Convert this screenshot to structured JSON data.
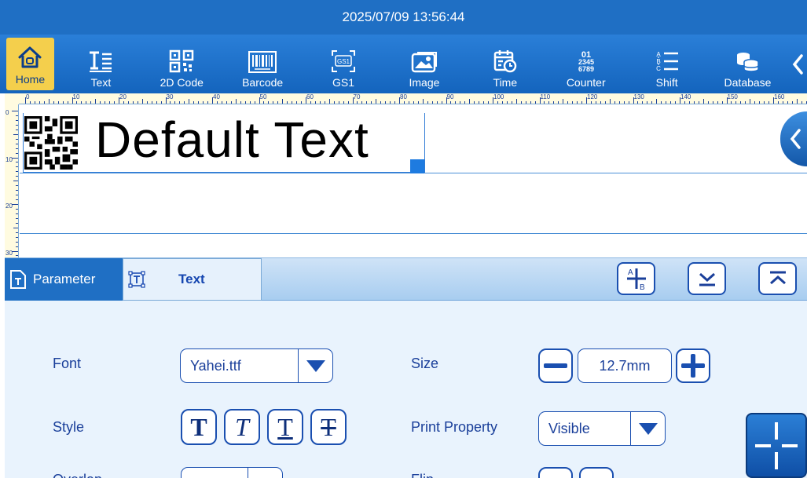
{
  "titlebar": {
    "datetime": "2025/07/09 13:56:44"
  },
  "toolbar": {
    "items": [
      {
        "label": "Home",
        "icon": "home-icon"
      },
      {
        "label": "Text",
        "icon": "text-icon"
      },
      {
        "label": "2D Code",
        "icon": "qr-code-icon"
      },
      {
        "label": "Barcode",
        "icon": "barcode-icon"
      },
      {
        "label": "GS1",
        "icon": "gs1-icon"
      },
      {
        "label": "Image",
        "icon": "image-icon"
      },
      {
        "label": "Time",
        "icon": "calendar-clock-icon"
      },
      {
        "label": "Counter",
        "icon": "counter-icon"
      },
      {
        "label": "Shift",
        "icon": "shift-icon"
      },
      {
        "label": "Database",
        "icon": "database-icon"
      }
    ],
    "counter_icon_text": [
      "01",
      "2345",
      "6789"
    ],
    "gs1_icon_text": "GS1",
    "more_icon": "chevron-left-icon"
  },
  "ruler": {
    "top_labels": [
      "0",
      "10",
      "20",
      "30",
      "40",
      "50",
      "60",
      "70",
      "80",
      "90",
      "100",
      "110",
      "120",
      "130",
      "140",
      "150",
      "160"
    ],
    "left_labels": [
      "0",
      "10",
      "20",
      "30"
    ]
  },
  "canvas": {
    "object_text": "Default Text"
  },
  "parambar": {
    "param_tab": "Parameter",
    "text_tab": "Text",
    "add_icon_letters": [
      "A",
      "B"
    ]
  },
  "panel": {
    "font": {
      "label": "Font",
      "value": "Yahei.ttf"
    },
    "size": {
      "label": "Size",
      "value": "12.7mm"
    },
    "style": {
      "label": "Style",
      "letters": [
        "T",
        "T",
        "T",
        "T"
      ]
    },
    "print_property": {
      "label": "Print Property",
      "value": "Visible"
    },
    "row3_left_label": "Overlap",
    "row3_right_label": "Flip"
  },
  "colors": {
    "accent": "#1f6fc4",
    "active_tool": "#f4cf4c",
    "label": "#1a3f9a"
  }
}
